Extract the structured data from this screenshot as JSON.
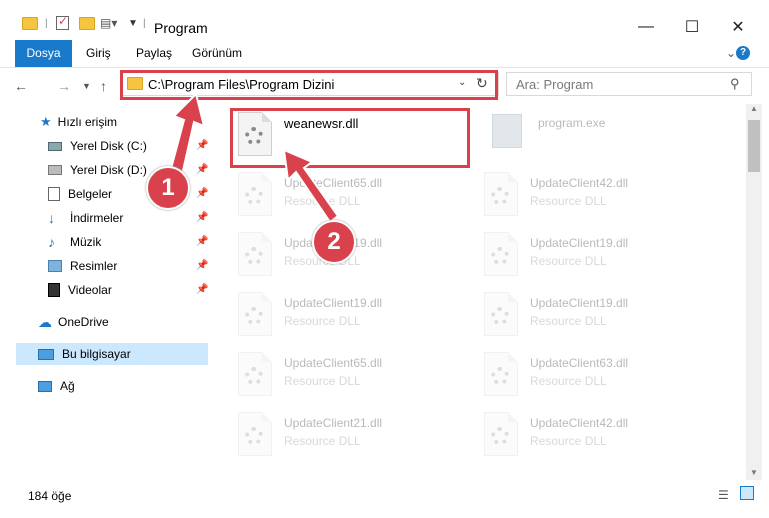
{
  "window": {
    "title": "Program",
    "minimize_glyph": "—",
    "maximize_glyph": "☐",
    "close_glyph": "✕"
  },
  "ribbon": {
    "tabs": [
      "Dosya",
      "Giriş",
      "Paylaş",
      "Görünüm"
    ],
    "expand_glyph": "⌄",
    "help_glyph": "?"
  },
  "address": {
    "path": "C:\\Program Files\\Program Dizini",
    "search_placeholder": "Ara: Program"
  },
  "sidebar": {
    "quick_access": "Hızlı erişim",
    "items": [
      {
        "label": "Yerel Disk (C:)",
        "icon": "drive-icon",
        "pinned": true
      },
      {
        "label": "Yerel Disk (D:)",
        "icon": "drive-icon",
        "pinned": true
      },
      {
        "label": "Belgeler",
        "icon": "documents-icon",
        "pinned": true
      },
      {
        "label": "İndirmeler",
        "icon": "download-icon",
        "pinned": true
      },
      {
        "label": "Müzik",
        "icon": "music-icon",
        "pinned": true
      },
      {
        "label": "Resimler",
        "icon": "pictures-icon",
        "pinned": true
      },
      {
        "label": "Videolar",
        "icon": "video-icon",
        "pinned": true
      }
    ],
    "onedrive": "OneDrive",
    "this_pc": "Bu bilgisayar",
    "network": "Ağ"
  },
  "files": {
    "highlighted": {
      "name": "weanewsr.dll",
      "type": ""
    },
    "top_right": {
      "name": "program.exe",
      "type": ""
    },
    "grid": [
      {
        "name": "UpdateClient65.dll",
        "type": "Resource DLL"
      },
      {
        "name": "UpdateClient42.dll",
        "type": "Resource DLL"
      },
      {
        "name": "UpdateClient19.dll",
        "type": "Resource DLL"
      },
      {
        "name": "UpdateClient19.dll",
        "type": "Resource DLL"
      },
      {
        "name": "UpdateClient19.dll",
        "type": "Resource DLL"
      },
      {
        "name": "UpdateClient19.dll",
        "type": "Resource DLL"
      },
      {
        "name": "UpdateClient65.dll",
        "type": "Resource DLL"
      },
      {
        "name": "UpdateClient63.dll",
        "type": "Resource DLL"
      },
      {
        "name": "UpdateClient21.dll",
        "type": "Resource DLL"
      },
      {
        "name": "UpdateClient42.dll",
        "type": "Resource DLL"
      }
    ]
  },
  "status": {
    "count": "184 öğe"
  },
  "callouts": {
    "one": "1",
    "two": "2"
  },
  "colors": {
    "accent": "#1979ca",
    "highlight": "#d9414c",
    "selection": "#cce8ff"
  }
}
